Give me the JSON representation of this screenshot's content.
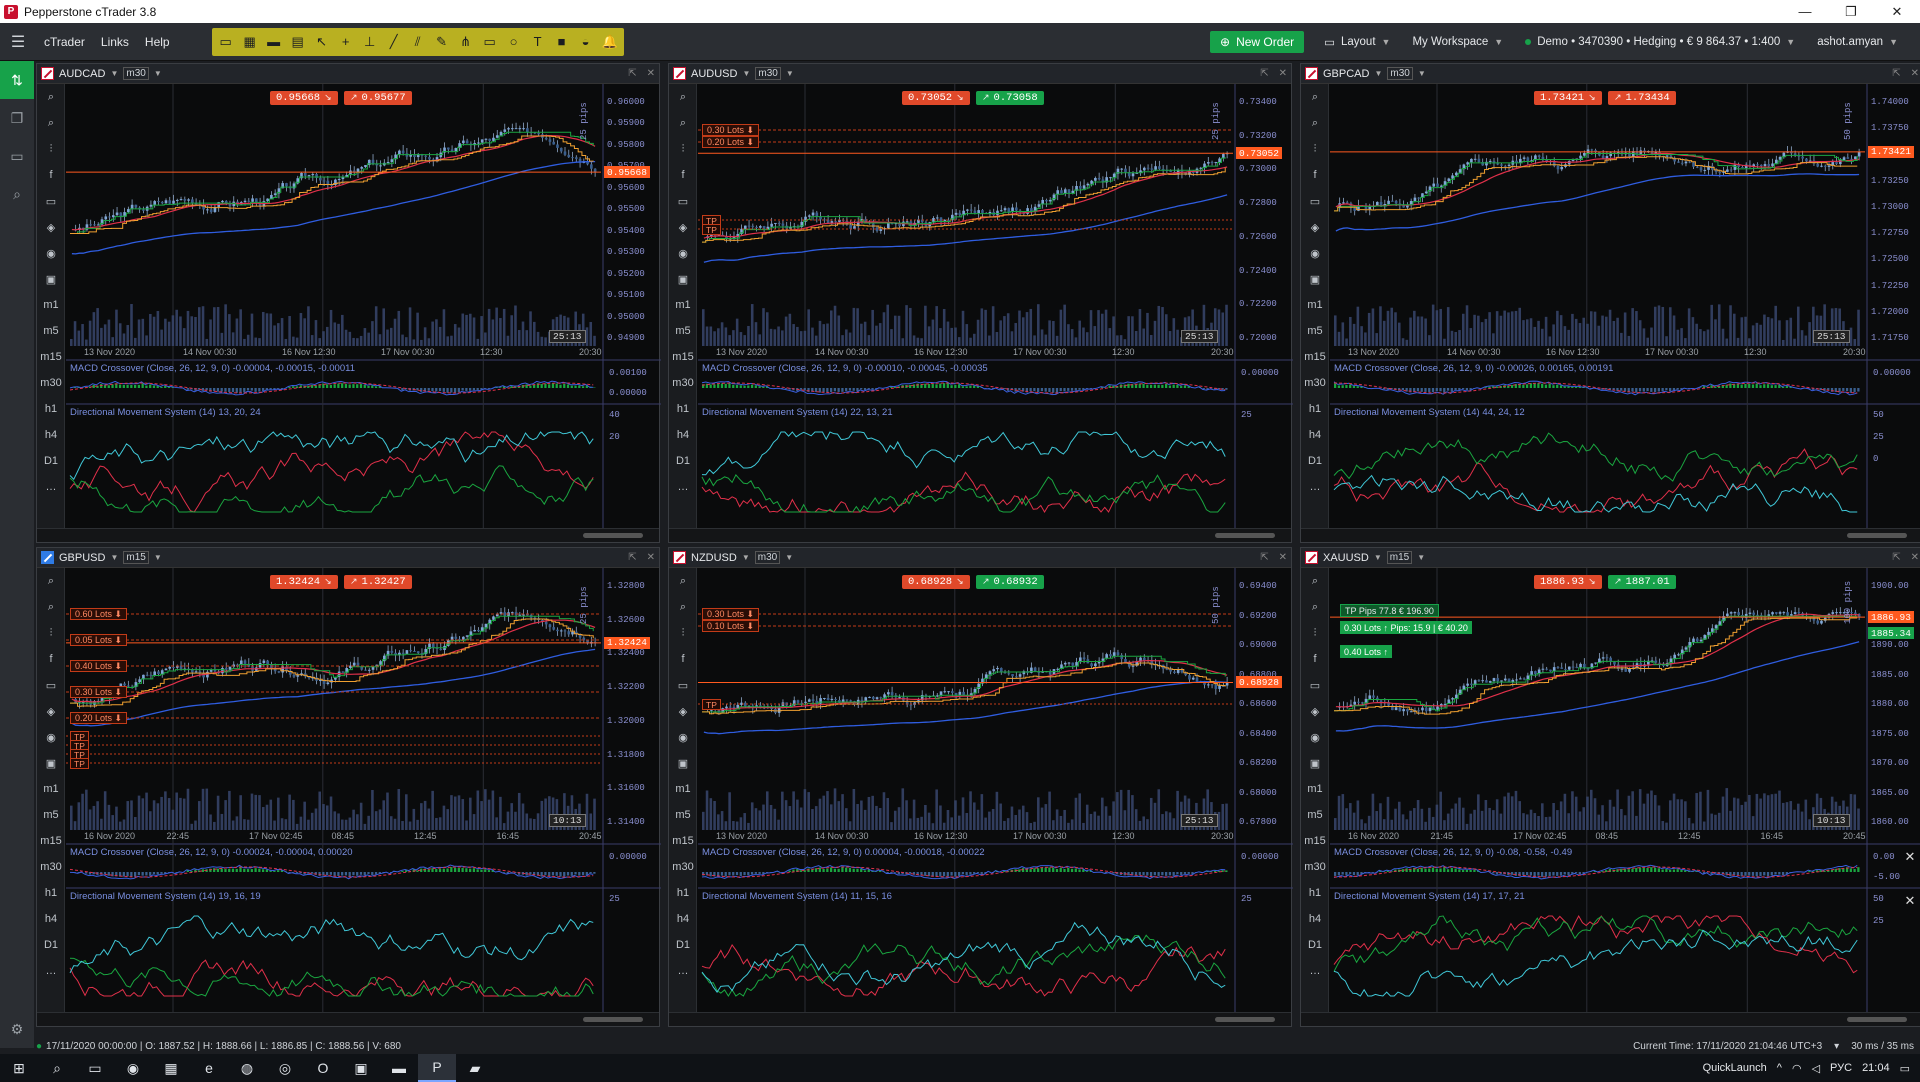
{
  "window": {
    "title": "Pepperstone cTrader 3.8"
  },
  "menu": {
    "items": [
      "cTrader",
      "Links",
      "Help"
    ]
  },
  "top": {
    "new_order": "New Order",
    "layout": "Layout",
    "workspace": "My Workspace",
    "account": "Demo • 3470390 • Hedging • € 9 864.37 • 1:400",
    "user": "ashot.amyan"
  },
  "colors": {
    "sell": "#e0492a",
    "buy": "#17a24a",
    "sma_short": "#f0a030",
    "sma_long": "#2f5de0",
    "ema": "#e0304a",
    "donchian": "#1aa640",
    "toolbar": "#b9b021"
  },
  "charts": [
    {
      "symbol": "AUDCAD",
      "timeframe": "m30",
      "sell": "0.95668",
      "buy": "0.95677",
      "last": "0.95668",
      "timer": "25:13",
      "pips": "25 pips",
      "yaxis": [
        "0.96000",
        "0.95900",
        "0.95800",
        "0.95700",
        "0.95600",
        "0.95500",
        "0.95400",
        "0.95300",
        "0.95200",
        "0.95100",
        "0.95000",
        "0.94900"
      ],
      "xaxis": [
        "13 Nov 2020",
        "14 Nov 00:30",
        "16 Nov 12:30",
        "17 Nov 00:30",
        "12:30",
        "20:30"
      ],
      "macd": "MACD Crossover (Close, 26, 12, 9, 0) -0.00004, -0.00015, -0.00011",
      "macd_axis": [
        "0.00100",
        "0.00000"
      ],
      "dms": "Directional Movement System (14) 13, 20, 24",
      "dms_axis": [
        "40",
        "20"
      ],
      "lots": [],
      "tps": []
    },
    {
      "symbol": "AUDUSD",
      "timeframe": "m30",
      "sell": "0.73052",
      "buy": "0.73058",
      "last": "0.73052",
      "timer": "25:13",
      "pips": "25 pips",
      "yaxis": [
        "0.73400",
        "0.73200",
        "0.73000",
        "0.72800",
        "0.72600",
        "0.72400",
        "0.72200",
        "0.72000"
      ],
      "xaxis": [
        "13 Nov 2020",
        "14 Nov 00:30",
        "16 Nov 12:30",
        "17 Nov 00:30",
        "12:30",
        "20:30"
      ],
      "macd": "MACD Crossover (Close, 26, 12, 9, 0) -0.00010, -0.00045, -0.00035",
      "macd_axis": [
        "0.00000"
      ],
      "dms": "Directional Movement System (14) 22, 13, 21",
      "dms_axis": [
        "25"
      ],
      "lots": [
        "0.30 Lots",
        "0.20 Lots"
      ],
      "tps": [
        "TP",
        "TP"
      ]
    },
    {
      "symbol": "GBPCAD",
      "timeframe": "m30",
      "sell": "1.73421",
      "buy": "1.73434",
      "last": "1.73421",
      "timer": "25:13",
      "pips": "50 pips",
      "yaxis": [
        "1.74000",
        "1.73750",
        "1.73500",
        "1.73250",
        "1.73000",
        "1.72750",
        "1.72500",
        "1.72250",
        "1.72000",
        "1.71750"
      ],
      "xaxis": [
        "13 Nov 2020",
        "14 Nov 00:30",
        "16 Nov 12:30",
        "17 Nov 00:30",
        "12:30",
        "20:30"
      ],
      "macd": "MACD Crossover (Close, 26, 12, 9, 0) -0.00026, 0.00165, 0.00191",
      "macd_axis": [
        "0.00000"
      ],
      "dms": "Directional Movement System (14) 44, 24, 12",
      "dms_axis": [
        "50",
        "25",
        "0"
      ],
      "lots": [],
      "tps": []
    },
    {
      "symbol": "GBPUSD",
      "timeframe": "m15",
      "sell": "1.32424",
      "buy": "1.32427",
      "last": "1.32424",
      "timer": "10:13",
      "pips": "25 pips",
      "yaxis": [
        "1.32800",
        "1.32600",
        "1.32400",
        "1.32200",
        "1.32000",
        "1.31800",
        "1.31600",
        "1.31400"
      ],
      "xaxis": [
        "16 Nov 2020",
        "22:45",
        "17 Nov 02:45",
        "08:45",
        "12:45",
        "16:45",
        "20:45"
      ],
      "macd": "MACD Crossover (Close, 26, 12, 9, 0) -0.00024, -0.00004, 0.00020",
      "macd_axis": [
        "0.00000"
      ],
      "dms": "Directional Movement System (14) 19, 16, 19",
      "dms_axis": [
        "25"
      ],
      "lots": [
        "0.60 Lots",
        "0.05 Lots",
        "0.40 Lots",
        "0.30 Lots",
        "0.20 Lots"
      ],
      "tps": [
        "TP",
        "TP",
        "TP",
        "TP"
      ]
    },
    {
      "symbol": "NZDUSD",
      "timeframe": "m30",
      "sell": "0.68928",
      "buy": "0.68932",
      "last": "0.68928",
      "timer": "25:13",
      "pips": "50 pips",
      "yaxis": [
        "0.69400",
        "0.69200",
        "0.69000",
        "0.68800",
        "0.68600",
        "0.68400",
        "0.68200",
        "0.68000",
        "0.67800"
      ],
      "xaxis": [
        "13 Nov 2020",
        "14 Nov 00:30",
        "16 Nov 12:30",
        "17 Nov 00:30",
        "12:30",
        "20:30"
      ],
      "macd": "MACD Crossover (Close, 26, 12, 9, 0) 0.00004, -0.00018, -0.00022",
      "macd_axis": [
        "0.00000"
      ],
      "dms": "Directional Movement System (14) 11, 15, 16",
      "dms_axis": [
        "25"
      ],
      "lots": [
        "0.30 Lots",
        "0.10 Lots"
      ],
      "tps": [
        "TP"
      ]
    },
    {
      "symbol": "XAUUSD",
      "timeframe": "m15",
      "sell": "1886.93",
      "buy": "1887.01",
      "last": "1886.93",
      "timer": "10:13",
      "pips": "100 pips",
      "yaxis": [
        "1900.00",
        "1895.00",
        "1890.00",
        "1885.00",
        "1880.00",
        "1875.00",
        "1870.00",
        "1865.00",
        "1860.00"
      ],
      "xaxis": [
        "16 Nov 2020",
        "21:45",
        "17 Nov 02:45",
        "08:45",
        "12:45",
        "16:45",
        "20:45"
      ],
      "macd": "MACD Crossover (Close, 26, 12, 9, 0) -0.08, -0.58, -0.49",
      "macd_axis": [
        "0.00",
        "-5.00"
      ],
      "dms": "Directional Movement System (14) 17, 17, 21",
      "dms_axis": [
        "50",
        "25"
      ],
      "lots": [],
      "tps": [],
      "position_a": "0.30 Lots ↑ Pips: 15.9 | € 40.20",
      "position_b": "0.40 Lots ↑",
      "tp_line": "TP  Pips 77.8  € 196.90",
      "right_tag": "1885.34"
    }
  ],
  "status": {
    "ohlc": "17/11/2020 00:00:00 | O: 1887.52 | H: 1888.66 | L: 1886.85 | C: 1888.56 | V: 680",
    "current_time": "Current Time:  17/11/2020 21:04:46   UTC+3",
    "latency": "30 ms / 35 ms"
  },
  "taskbar": {
    "quicklaunch": "QuickLaunch",
    "lang": "РУС",
    "clock": "21:04"
  }
}
